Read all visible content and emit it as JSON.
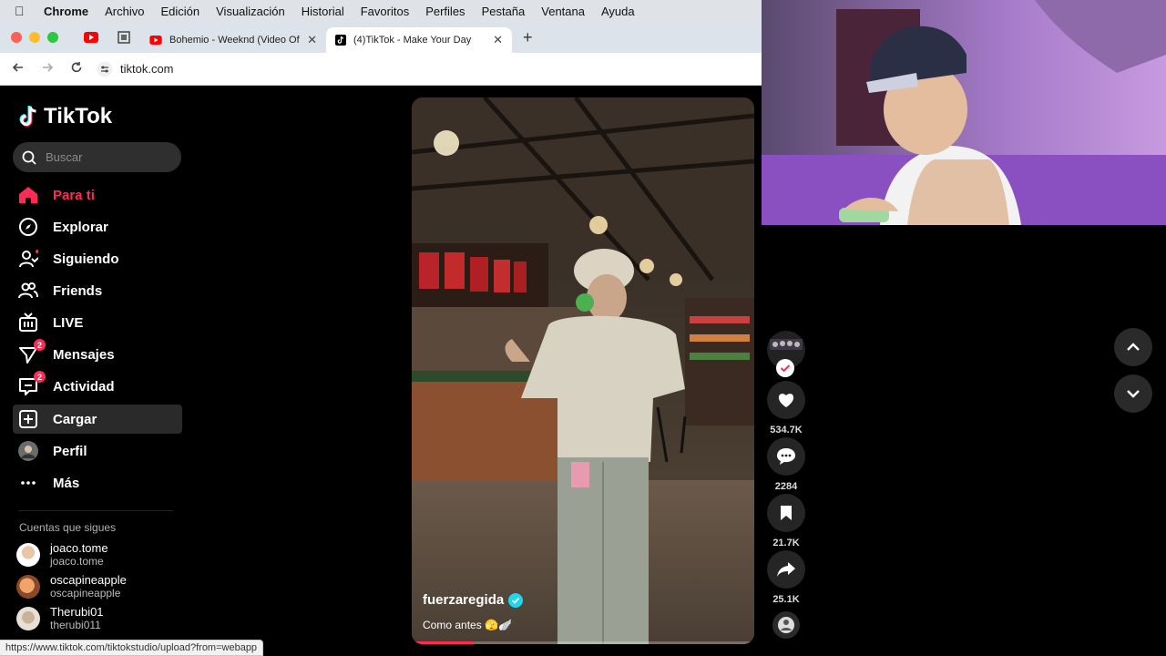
{
  "menubar": {
    "items": [
      "Chrome",
      "Archivo",
      "Edición",
      "Visualización",
      "Historial",
      "Favoritos",
      "Perfiles",
      "Pestaña",
      "Ventana",
      "Ayuda"
    ]
  },
  "tabs": [
    {
      "title": "Bohemio - Weeknd (Video Of",
      "icon": "youtube-icon"
    },
    {
      "title": "(4)TikTok - Make Your Day",
      "icon": "tiktok-icon"
    }
  ],
  "address": {
    "url": "tiktok.com"
  },
  "sidebar": {
    "logo": "TikTok",
    "search_placeholder": "Buscar",
    "nav": [
      {
        "label": "Para ti",
        "icon": "home-icon"
      },
      {
        "label": "Explorar",
        "icon": "compass-icon"
      },
      {
        "label": "Siguiendo",
        "icon": "following-icon"
      },
      {
        "label": "Friends",
        "icon": "friends-icon"
      },
      {
        "label": "LIVE",
        "icon": "live-icon"
      },
      {
        "label": "Mensajes",
        "icon": "messages-icon",
        "badge": "2"
      },
      {
        "label": "Actividad",
        "icon": "activity-icon",
        "badge": "2"
      },
      {
        "label": "Cargar",
        "icon": "upload-icon"
      },
      {
        "label": "Perfil",
        "icon": "profile-avatar"
      },
      {
        "label": "Más",
        "icon": "more-icon"
      }
    ],
    "following_title": "Cuentas que sigues",
    "following": [
      {
        "name": "joaco.tome",
        "handle": "joaco.tome"
      },
      {
        "name": "oscapineapple",
        "handle": "oscapineapple"
      },
      {
        "name": "Therubi01",
        "handle": "therubi011"
      }
    ]
  },
  "video": {
    "username": "fuerzaregida",
    "caption": "Como antes 🫣🪽",
    "progress": 0.18
  },
  "actions": {
    "likes": "534.7K",
    "comments": "2284",
    "saves": "21.7K",
    "shares": "25.1K"
  },
  "status_url": "https://www.tiktok.com/tiktokstudio/upload?from=webapp",
  "colors": {
    "accent": "#fe2c55",
    "background": "#000000"
  }
}
